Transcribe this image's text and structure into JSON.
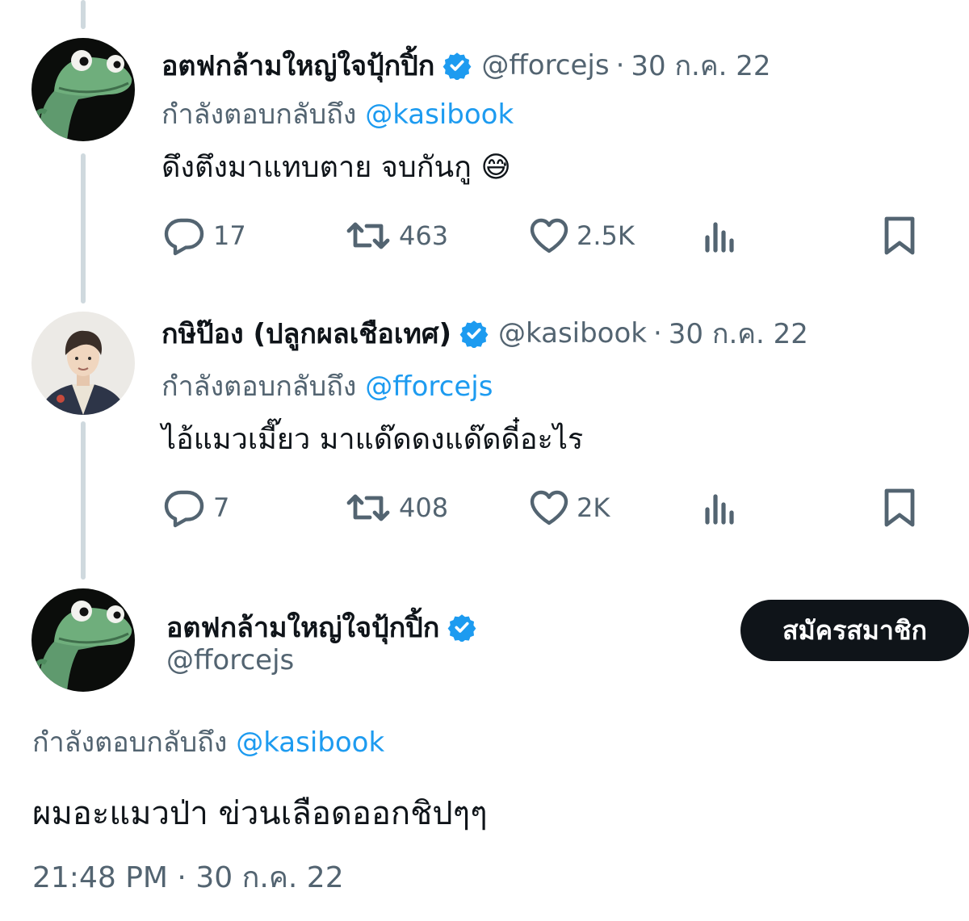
{
  "colors": {
    "accent": "#1d9bf0",
    "text": "#0f1419",
    "secondary": "#536471",
    "thread_line": "#cfd9de"
  },
  "reply_prefix": "กำลังตอบกลับถึง",
  "tweets": [
    {
      "display_name": "อตฟกล้ามใหญ่ใจปุ้กปิ้ก",
      "handle": "@fforcejs",
      "dot": "·",
      "date": "30 ก.ค. 22",
      "reply_to": "@kasibook",
      "text": "ดึงตึงมาแทบตาย จบกันกู 😅",
      "replies": "17",
      "retweets": "463",
      "likes": "2.5K"
    },
    {
      "display_name": "กษิป๊อง (ปลูกผลเชือเทศ)",
      "handle": "@kasibook",
      "dot": "·",
      "date": "30 ก.ค. 22",
      "reply_to": "@fforcejs",
      "text": "ไอ้แมวเมี๊ยว มาแด๊ดดงแด๊ดดี๋อะไร",
      "replies": "7",
      "retweets": "408",
      "likes": "2K"
    }
  ],
  "main_tweet": {
    "display_name": "อตฟกล้ามใหญ่ใจปุ้กปิ้ก",
    "handle": "@fforcejs",
    "subscribe_label": "สมัครสมาชิก",
    "reply_to": "@kasibook",
    "text": "ผมอะแมวป่า ข่วนเลือดออกชิปๆๆ",
    "time": "21:48 PM",
    "dot": "·",
    "date": "30 ก.ค. 22"
  },
  "icons": {
    "verified": "verified-badge-icon",
    "reply": "reply-icon",
    "retweet": "retweet-icon",
    "like": "heart-icon",
    "views": "views-icon",
    "bookmark": "bookmark-icon"
  }
}
